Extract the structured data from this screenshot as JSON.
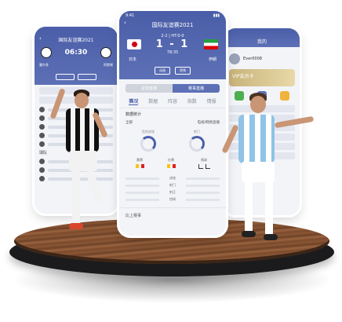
{
  "left_phone": {
    "title": "国际友谊赛2021",
    "time": "06:30",
    "team_home": "塞尔多",
    "team_away": "阿斯顿",
    "tabs": [
      "",
      ""
    ],
    "section_label": "球队"
  },
  "center_phone": {
    "status_time": "9:41",
    "title": "国际友谊赛2021",
    "half_label": "2-2 | HT:0-0",
    "score": "1 - 1",
    "minute": "78:35",
    "team_home": "日本",
    "team_away": "伊朗",
    "mini_tabs": [
      "动画",
      "视频"
    ],
    "segments": [
      "足球直播",
      "赛事直播"
    ],
    "tabs": [
      "赛况",
      "数据",
      "阵容",
      "指数",
      "情报"
    ],
    "section_title": "数据统计",
    "dropdown_left": "全部",
    "dropdown_right": "电视/网络直播",
    "ring_left_label": "危险进攻",
    "ring_right_label": "射门",
    "card_cols": [
      "黄牌",
      "红牌",
      "角球"
    ],
    "stats": [
      "进攻",
      "射门",
      "射正",
      "控球"
    ],
    "bottom_text": "比上赛事"
  },
  "right_phone": {
    "title": "我的",
    "user": "Ever0008",
    "promo": "VIP会员卡",
    "promo_btn": "立即开通"
  },
  "colors": {
    "header": "#4a5ea8",
    "accent": "#5d70b6",
    "wood": "#7a4a2c",
    "podium": "#1b1b1d"
  }
}
